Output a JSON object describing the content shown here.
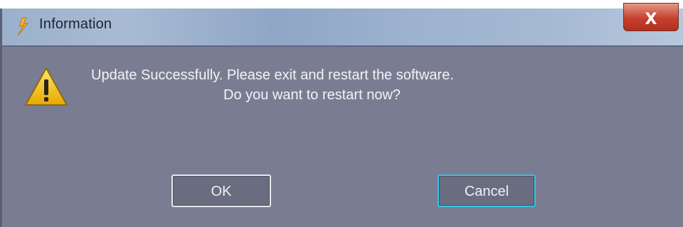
{
  "window": {
    "title": "Information",
    "title_icon": "app-logo-icon",
    "close_glyph": "X",
    "close_icon": "close-icon"
  },
  "message": {
    "icon": "warning-icon",
    "line1": "Update Successfully. Please exit and restart the software.",
    "line2": "Do you want to restart now?"
  },
  "buttons": {
    "ok_label": "OK",
    "cancel_label": "Cancel"
  },
  "colors": {
    "dialog_background": "#7a7d92",
    "titlebar": "#9cb2cf",
    "close_button": "#c6402e",
    "cancel_focus_border": "#35c3e3",
    "warning_yellow": "#f5c400"
  }
}
